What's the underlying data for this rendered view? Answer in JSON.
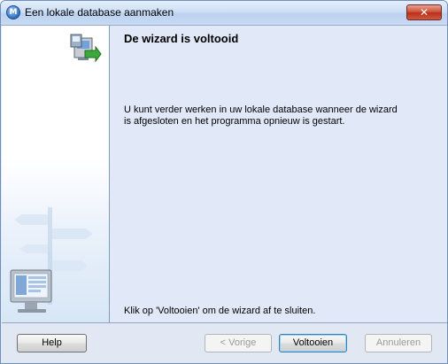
{
  "window": {
    "title": "Een lokale database aanmaken",
    "app_icon_letter": "M",
    "close_symbol": "✕"
  },
  "content": {
    "heading": "De wizard is voltooid",
    "body_line1": "U kunt verder werken in uw lokale database wanneer de wizard",
    "body_line2": "is afgesloten en het programma opnieuw is gestart.",
    "footer": "Klik op 'Voltooien' om de wizard af te sluiten."
  },
  "buttons": {
    "help": "Help",
    "previous": "< Vorige",
    "finish": "Voltooien",
    "cancel": "Annuleren"
  },
  "icons": {
    "header": "computer-with-green-arrow-icon",
    "sidebar_art": "signpost-and-monitor-illustration"
  },
  "colors": {
    "accent": "#2f6fbe",
    "close_red": "#c0392b",
    "arrow_green": "#3aa83a"
  }
}
